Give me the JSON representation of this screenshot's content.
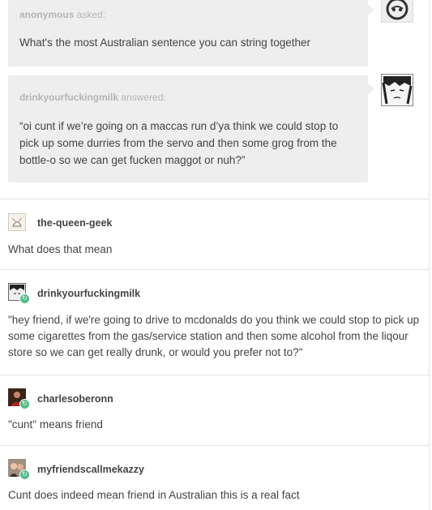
{
  "ask": {
    "asker": "anonymous",
    "verb": "asked:",
    "question": "What's the most Australian sentence you can string together"
  },
  "answer": {
    "answerer": "drinkyourfuckingmilk",
    "verb": "answered:",
    "text": "“oi cunt if we’re going on a maccas run d’ya think we could stop to pick up some durries from the servo and then some grog from the bottle-o so we can get fucken maggot or nuh?”"
  },
  "notes": [
    {
      "user": "the-queen-geek",
      "text": "What does that mean"
    },
    {
      "user": "drinkyourfuckingmilk",
      "text": "\"hey friend, if we're going to drive to mcdonalds do you think we could stop to pick up some cigarettes from the gas/service station and then some alcohol from the liqour store so we can get really drunk, or would you prefer not to?\""
    },
    {
      "user": "charlesoberonn",
      "text": "\"cunt\" means friend"
    },
    {
      "user": "myfriendscallmekazzy",
      "text": "Cunt does indeed mean friend in Australian this is a real fact"
    }
  ],
  "colors": {
    "badge": "#56bc8a",
    "bubble": "#eeeeee",
    "text": "#444444",
    "meta": "#b5b5b5"
  }
}
